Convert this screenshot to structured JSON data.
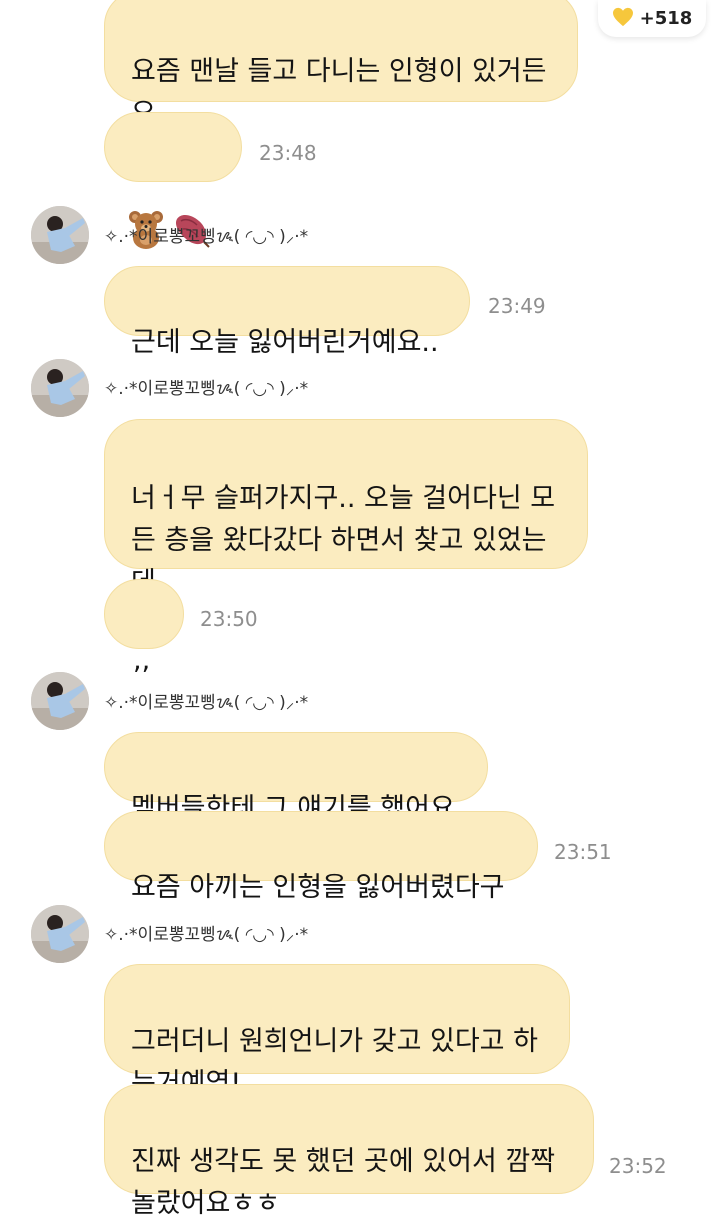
{
  "badge": {
    "icon": "yellow-heart-icon",
    "count": "+518"
  },
  "nickname": "✧.·*이로뽕꼬삥ᝰ( ◜◡◝ )⸝·*",
  "messages": {
    "m1": "요즘 맨날 들고 다니는 인형이 있거든\n요",
    "m2_icons": [
      "teddy-bear-icon",
      "sweet-potato-icon"
    ],
    "m2_time": "23:48",
    "m3": "근데 오늘 잃어버린거예요..",
    "m3_time": "23:49",
    "m4": "너ㅓ무 슬퍼가지구.. 오늘 걸어다닌 모\n든 층을 왔다갔다 하면서 찾고 있었는\n데",
    "m5": ",,",
    "m5_time": "23:50",
    "m6": "멤버들한테 그 얘기를 했어요",
    "m7": "요즘 아끼는 인형을 잃어버렸다구",
    "m7_time": "23:51",
    "m8": "그러더니 원희언니가 갖고 있다고 하\n는거예영!",
    "m9": "진짜 생각도 못 했던 곳에 있어서 깜짝\n놀랐어요ㅎㅎ",
    "m9_time": "23:52"
  }
}
